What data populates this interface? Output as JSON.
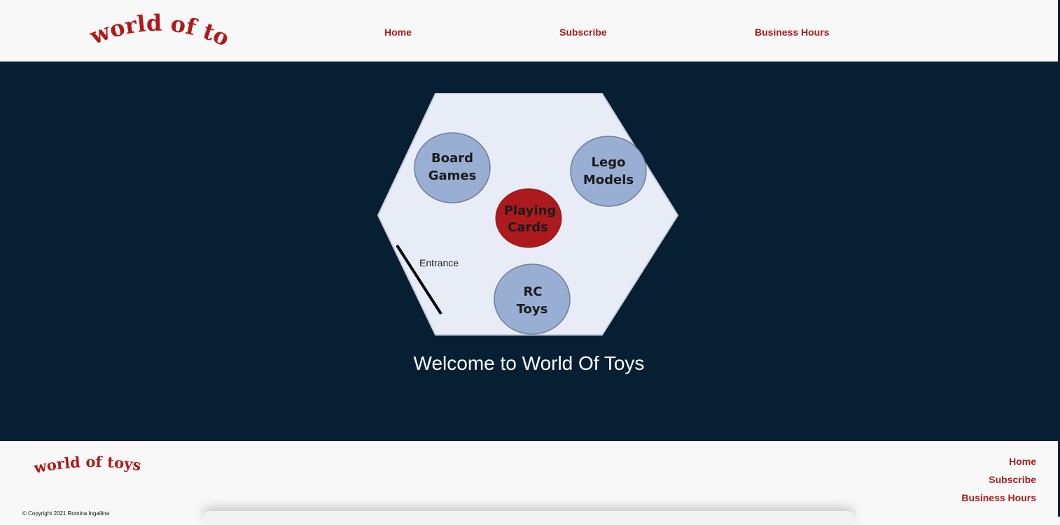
{
  "brand": {
    "name": "world of toys",
    "color": "#b11a1a"
  },
  "nav": {
    "items": [
      {
        "label": "Home"
      },
      {
        "label": "Subscribe"
      },
      {
        "label": "Business Hours"
      }
    ]
  },
  "hero": {
    "welcome_text": "Welcome to World Of Toys",
    "background_color": "#061f33",
    "floor_map": {
      "sections": [
        {
          "line1": "Board",
          "line2": "Games",
          "color": "#98afd3"
        },
        {
          "line1": "Lego",
          "line2": "Models",
          "color": "#98afd3"
        },
        {
          "line1": "Playing",
          "line2": "Cards",
          "color": "#ad1a1d"
        },
        {
          "line1": "RC",
          "line2": "Toys",
          "color": "#98afd3"
        }
      ],
      "entrance_label": "Entrance"
    }
  },
  "footer": {
    "links": [
      {
        "label": "Home"
      },
      {
        "label": "Subscribe"
      },
      {
        "label": "Business Hours"
      }
    ],
    "copyright": "© Copyright 2021 Romina Ingallina"
  }
}
